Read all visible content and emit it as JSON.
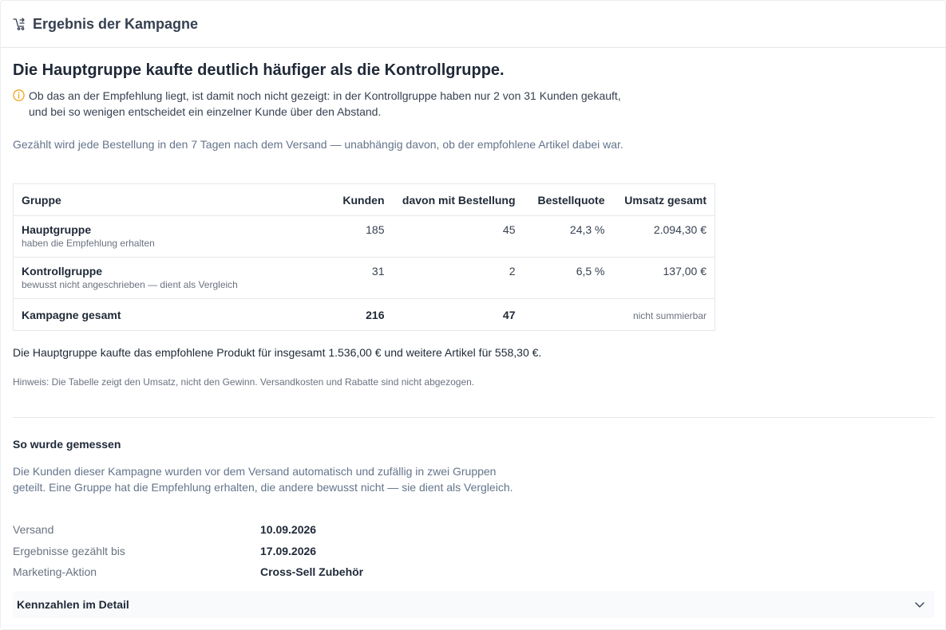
{
  "header": {
    "title": "Ergebnis der Kampagne",
    "icon": "cart-arrow-icon"
  },
  "headline": "Die Hauptgruppe kaufte deutlich häufiger als die Kontrollgruppe.",
  "warning": {
    "icon": "info-circle-icon",
    "text": "Ob das an der Empfehlung liegt, ist damit noch nicht gezeigt: in der Kontrollgruppe haben nur 2 von 31 Kunden gekauft, und bei so wenigen entscheidet ein einzelner Kunde über den Abstand."
  },
  "note": "Gezählt wird jede Bestellung in den 7 Tagen nach dem Versand — unabhängig davon, ob der empfohlene Artikel dabei war.",
  "table": {
    "headers": [
      "Gruppe",
      "Kunden",
      "davon mit Bestellung",
      "Bestellquote",
      "Umsatz gesamt"
    ],
    "rows": [
      {
        "name": "Hauptgruppe",
        "sub": "haben die Empfehlung erhalten",
        "kunden": "185",
        "bestellungen": "45",
        "quote": "24,3 %",
        "umsatz": "2.094,30 €"
      },
      {
        "name": "Kontrollgruppe",
        "sub": "bewusst nicht angeschrieben — dient als Vergleich",
        "kunden": "31",
        "bestellungen": "2",
        "quote": "6,5 %",
        "umsatz": "137,00 €"
      }
    ],
    "total": {
      "name": "Kampagne gesamt",
      "kunden": "216",
      "bestellungen": "47",
      "umsatz": "nicht summierbar"
    }
  },
  "summary": "Die Hauptgruppe kaufte das empfohlene Produkt für insgesamt 1.536,00 € und weitere Artikel für 558,30 €.",
  "hint": "Hinweis: Die Tabelle zeigt den Umsatz, nicht den Gewinn. Versandkosten und Rabatte sind nicht abgezogen.",
  "method": {
    "title": "So wurde gemessen",
    "text": "Die Kunden dieser Kampagne wurden vor dem Versand automatisch und zufällig in zwei Gruppen geteilt. Eine Gruppe hat die Empfehlung erhalten, die andere bewusst nicht — sie dient als Vergleich.",
    "meta": [
      {
        "label": "Versand",
        "value": "10.09.2026"
      },
      {
        "label": "Ergebnisse gezählt bis",
        "value": "17.09.2026"
      },
      {
        "label": "Marketing-Aktion",
        "value": "Cross-Sell Zubehör"
      }
    ]
  },
  "details": {
    "label": "Kennzahlen im Detail",
    "icon": "chevron-down-icon"
  },
  "colors": {
    "warning": "#f59e0b",
    "muted": "#64748b"
  }
}
